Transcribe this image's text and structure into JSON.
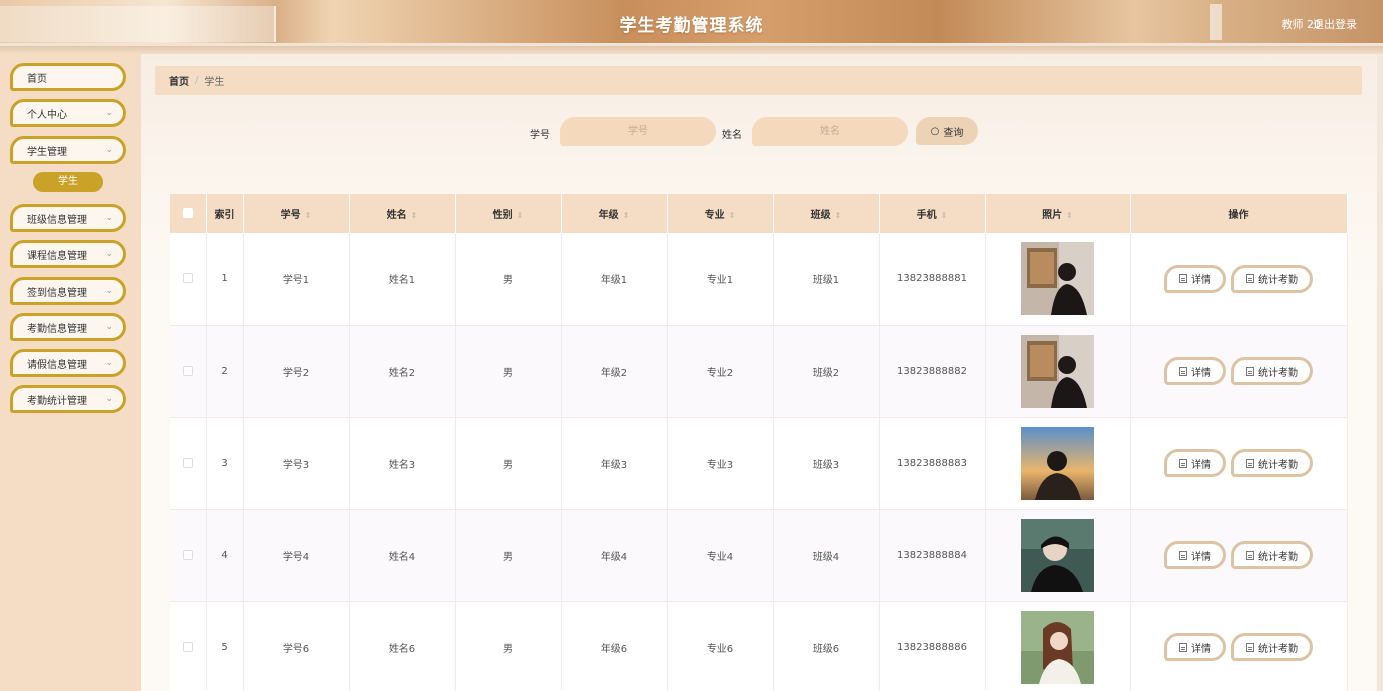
{
  "header": {
    "title": "学生考勤管理系统",
    "user": "教师 20",
    "logout": "退出登录"
  },
  "sidebar": {
    "items": [
      {
        "label": "首页",
        "has_arrow": false
      },
      {
        "label": "个人中心",
        "has_arrow": true
      },
      {
        "label": "学生管理",
        "has_arrow": true
      },
      {
        "label": "班级信息管理",
        "has_arrow": true
      },
      {
        "label": "课程信息管理",
        "has_arrow": true
      },
      {
        "label": "签到信息管理",
        "has_arrow": true
      },
      {
        "label": "考勤信息管理",
        "has_arrow": true
      },
      {
        "label": "请假信息管理",
        "has_arrow": true
      },
      {
        "label": "考勤统计管理",
        "has_arrow": true
      }
    ],
    "active_sub": "学生"
  },
  "breadcrumb": {
    "home": "首页",
    "sep": "/",
    "current": "学生"
  },
  "search": {
    "id_label": "学号",
    "id_placeholder": "学号",
    "name_label": "姓名",
    "name_placeholder": "姓名",
    "query_icon": "search-icon",
    "query_label": "查询"
  },
  "table": {
    "columns": [
      "索引",
      "学号",
      "姓名",
      "性别",
      "年级",
      "专业",
      "班级",
      "手机",
      "照片",
      "操作"
    ],
    "rows": [
      {
        "index": "1",
        "id": "学号1",
        "name": "姓名1",
        "gender": "男",
        "grade": "年级1",
        "major": "专业1",
        "class": "班级1",
        "phone": "13823888881",
        "photo": "photo-1"
      },
      {
        "index": "2",
        "id": "学号2",
        "name": "姓名2",
        "gender": "男",
        "grade": "年级2",
        "major": "专业2",
        "class": "班级2",
        "phone": "13823888882",
        "photo": "photo-2"
      },
      {
        "index": "3",
        "id": "学号3",
        "name": "姓名3",
        "gender": "男",
        "grade": "年级3",
        "major": "专业3",
        "class": "班级3",
        "phone": "13823888883",
        "photo": "photo-3"
      },
      {
        "index": "4",
        "id": "学号4",
        "name": "姓名4",
        "gender": "男",
        "grade": "年级4",
        "major": "专业4",
        "class": "班级4",
        "phone": "13823888884",
        "photo": "photo-4"
      },
      {
        "index": "5",
        "id": "学号6",
        "name": "姓名6",
        "gender": "男",
        "grade": "年级6",
        "major": "专业6",
        "class": "班级6",
        "phone": "13823888886",
        "photo": "photo-5"
      }
    ],
    "actions": {
      "detail": "详情",
      "stats": "统计考勤"
    }
  },
  "colors": {
    "accent": "#c9a227",
    "panel": "#f4ddc4"
  }
}
